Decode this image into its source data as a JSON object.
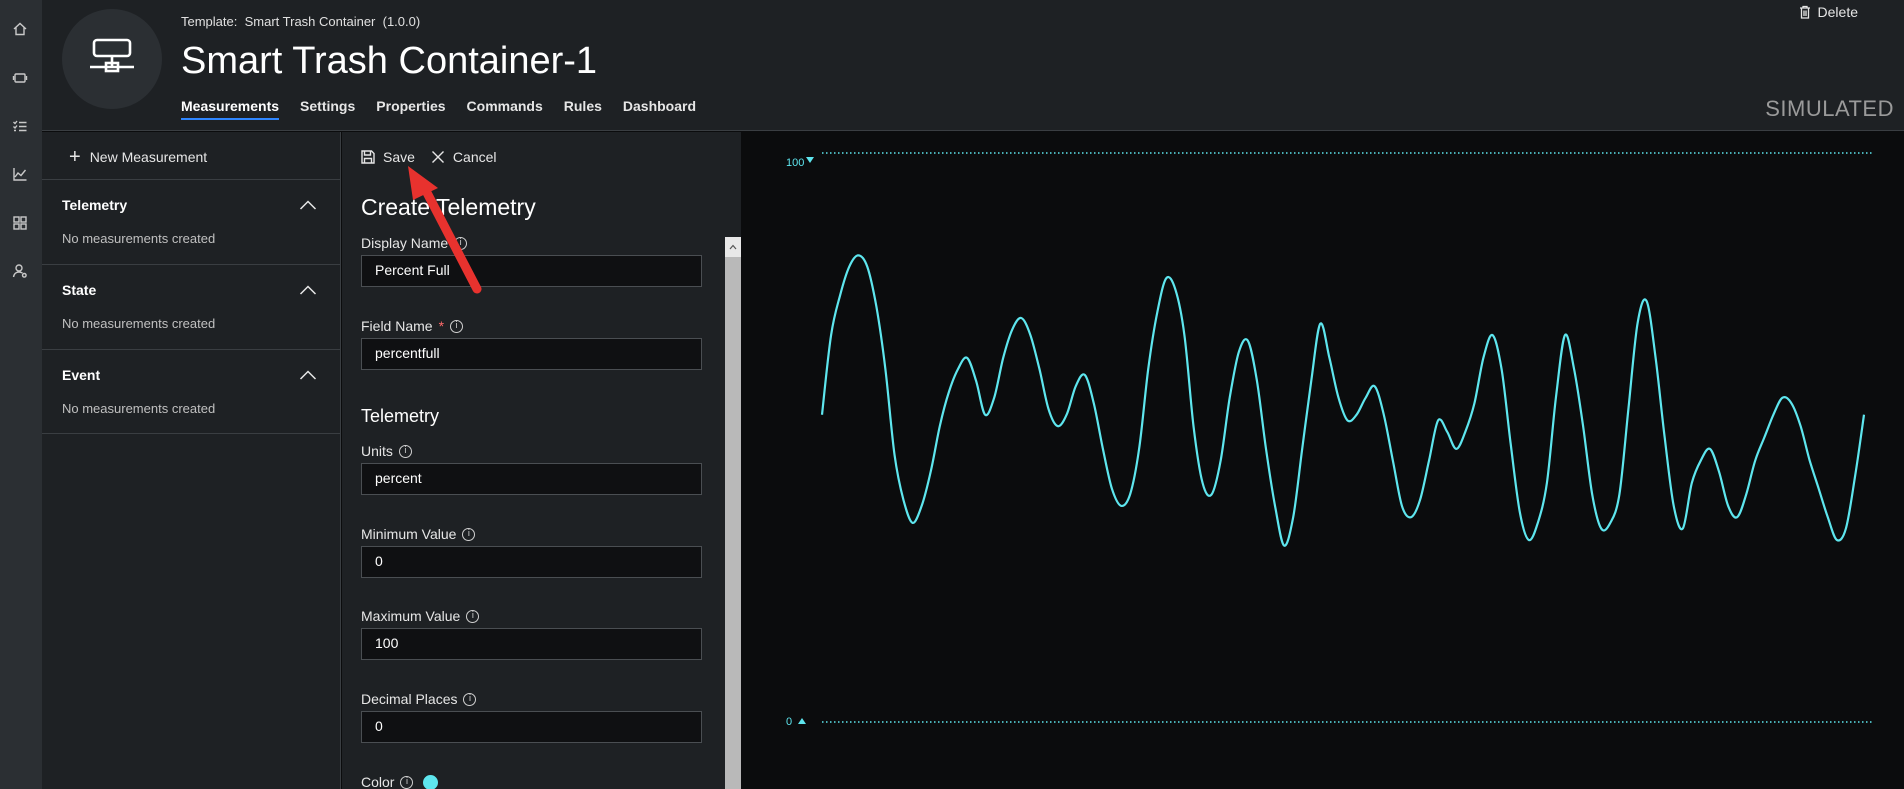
{
  "nav_rail": {
    "icons": [
      "home-icon",
      "devices-icon",
      "device-templates-icon",
      "analytics-icon",
      "dashboards-icon",
      "administration-icon"
    ]
  },
  "header": {
    "template_label": "Template:",
    "template_name": "Smart Trash Container",
    "template_version": "(1.0.0)",
    "device_title": "Smart Trash Container-1",
    "delete_label": "Delete",
    "simulated_label": "SIMULATED",
    "tabs": [
      {
        "label": "Measurements",
        "active": true
      },
      {
        "label": "Settings",
        "active": false
      },
      {
        "label": "Properties",
        "active": false
      },
      {
        "label": "Commands",
        "active": false
      },
      {
        "label": "Rules",
        "active": false
      },
      {
        "label": "Dashboard",
        "active": false
      }
    ]
  },
  "left_panel": {
    "new_measurement_label": "New Measurement",
    "sections": [
      {
        "title": "Telemetry",
        "empty_text": "No measurements created"
      },
      {
        "title": "State",
        "empty_text": "No measurements created"
      },
      {
        "title": "Event",
        "empty_text": "No measurements created"
      }
    ]
  },
  "form": {
    "save_label": "Save",
    "cancel_label": "Cancel",
    "title": "Create Telemetry",
    "display_name_label": "Display Name",
    "display_name_value": "Percent Full",
    "field_name_label": "Field Name",
    "field_name_required": "*",
    "field_name_value": "percentfull",
    "telemetry_subheading": "Telemetry",
    "units_label": "Units",
    "units_value": "percent",
    "min_label": "Minimum Value",
    "min_value": "0",
    "max_label": "Maximum Value",
    "max_value": "100",
    "decimal_label": "Decimal Places",
    "decimal_value": "0",
    "color_label": "Color",
    "color_value": "#5ee6ee"
  },
  "chart_data": {
    "type": "line",
    "ylim": [
      0,
      100
    ],
    "top_label": "100",
    "bottom_label": "0",
    "line_color": "#5ee6ee",
    "series": [
      {
        "values": [
          54,
          68,
          75,
          80,
          82,
          80,
          73,
          62,
          47,
          39,
          35,
          38,
          44,
          52,
          58,
          62,
          64,
          60,
          54,
          57,
          64,
          69,
          71,
          68,
          62,
          55,
          52,
          54,
          59,
          61,
          56,
          48,
          41,
          38,
          40,
          48,
          62,
          72,
          78,
          76,
          68,
          52,
          42,
          40,
          46,
          57,
          65,
          67,
          60,
          48,
          38,
          31,
          36,
          48,
          60,
          70,
          64,
          57,
          53,
          54,
          57,
          59,
          54,
          46,
          38,
          36,
          39,
          46,
          53,
          51,
          48,
          51,
          56,
          64,
          68,
          62,
          49,
          37,
          32,
          35,
          42,
          57,
          68,
          62,
          52,
          40,
          34,
          35,
          40,
          55,
          70,
          74,
          64,
          50,
          38,
          34,
          42,
          46,
          48,
          44,
          38,
          36,
          40,
          46,
          50,
          54,
          57,
          56,
          52,
          46,
          41,
          36,
          32,
          34,
          43,
          54
        ]
      }
    ]
  }
}
